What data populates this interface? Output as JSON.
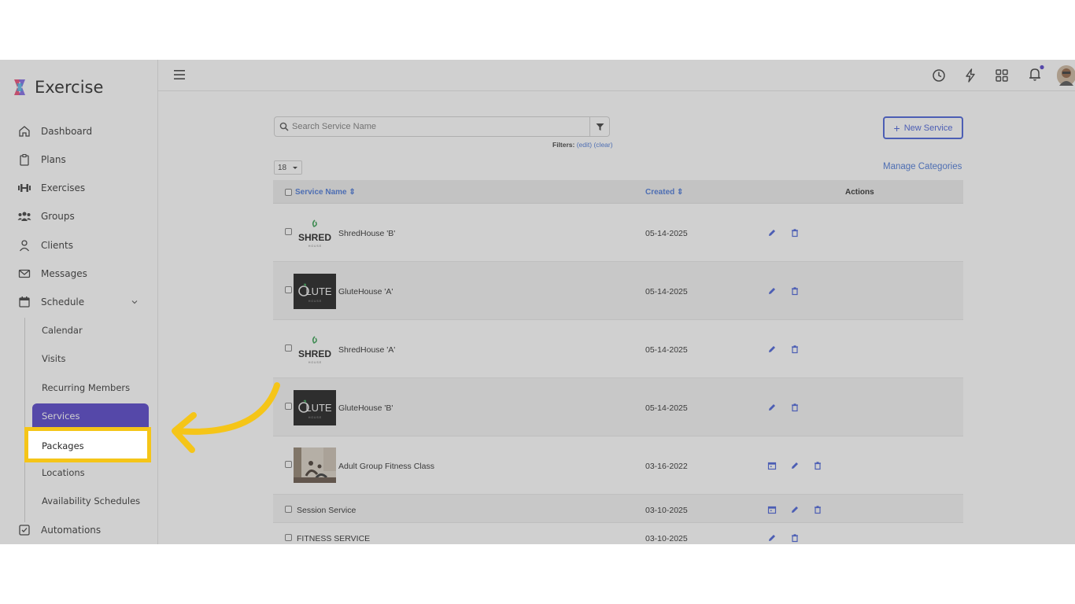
{
  "app": {
    "name": "Exercise"
  },
  "sidebar": {
    "items": [
      {
        "label": "Dashboard",
        "icon": "home-icon"
      },
      {
        "label": "Plans",
        "icon": "clipboard-icon"
      },
      {
        "label": "Exercises",
        "icon": "dumbbell-icon"
      },
      {
        "label": "Groups",
        "icon": "users-icon"
      },
      {
        "label": "Clients",
        "icon": "user-icon"
      },
      {
        "label": "Messages",
        "icon": "mail-icon"
      },
      {
        "label": "Schedule",
        "icon": "calendar-icon"
      }
    ],
    "schedule_sub": [
      {
        "label": "Calendar"
      },
      {
        "label": "Visits"
      },
      {
        "label": "Recurring Members"
      },
      {
        "label": "Services"
      },
      {
        "label": "Packages"
      },
      {
        "label": "Locations"
      },
      {
        "label": "Availability Schedules"
      }
    ],
    "automations": {
      "label": "Automations",
      "icon": "checkbox-icon"
    },
    "active_color": "#4a37c6"
  },
  "toolbar": {
    "search_placeholder": "Search Service Name",
    "filters_label": "Filters:",
    "filters_edit": "(edit)",
    "filters_clear": "(clear)",
    "new_service_label": "New Service",
    "page_size": "18",
    "manage_categories": "Manage Categories"
  },
  "table": {
    "columns": {
      "name": "Service Name",
      "created": "Created",
      "actions": "Actions"
    },
    "rows": [
      {
        "name": "ShredHouse 'B'",
        "created": "05-14-2025",
        "thumb": "shred"
      },
      {
        "name": "GluteHouse 'A'",
        "created": "05-14-2025",
        "thumb": "glute"
      },
      {
        "name": "ShredHouse 'A'",
        "created": "05-14-2025",
        "thumb": "shred"
      },
      {
        "name": "GluteHouse 'B'",
        "created": "05-14-2025",
        "thumb": "glute"
      },
      {
        "name": "Adult Group Fitness Class",
        "created": "03-16-2022",
        "thumb": "photo"
      },
      {
        "name": "Session Service",
        "created": "03-10-2025",
        "thumb": "none"
      },
      {
        "name": "FITNESS SERVICE",
        "created": "03-10-2025",
        "thumb": "none"
      }
    ],
    "thumb_text": {
      "shred": "SHRED",
      "glute": "LUTE"
    }
  },
  "highlight": {
    "color": "#f5c518"
  }
}
